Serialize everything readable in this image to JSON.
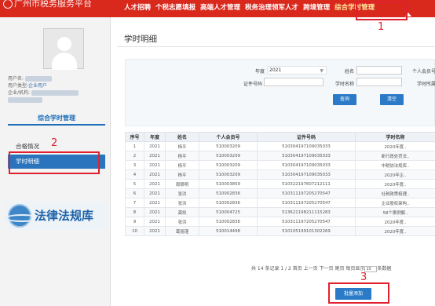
{
  "header": {
    "brand": "广州市税务服务平台",
    "nav": [
      "人才招聘",
      "个税志愿填报",
      "高端人才管理",
      "税务治理领军人才",
      "跨境管理",
      "综合学时管理"
    ],
    "active": "综合学时管理"
  },
  "sidebar": {
    "user_name_label": "用户名:",
    "user_type_label": "用户类型:",
    "user_type_value": "企业用户",
    "org_label": "企业/机构:",
    "section_title": "综合学时管理",
    "items": [
      "合格情况",
      "学时明细"
    ],
    "active_item": "学时明细",
    "law_label": "法律法规库"
  },
  "main": {
    "title": "学时明细",
    "filter": {
      "year_label": "年度",
      "year_value": "2021",
      "name_label": "姓名",
      "member_label": "个人会员号",
      "cert_label": "证件号码",
      "course_label": "学时名称",
      "other_label": "学时所属",
      "query_button": "查询",
      "clear_button": "清空"
    },
    "table": {
      "headers": [
        "序号",
        "年度",
        "姓名",
        "个人会员号",
        "证件号码",
        "学时名称"
      ],
      "rows": [
        [
          "1",
          "2021",
          "杨平",
          "510003209",
          "510304197109035033",
          "2020年度.."
        ],
        [
          "2",
          "2021",
          "杨平",
          "510003209",
          "510304197109035033",
          "新行政处罚法.."
        ],
        [
          "3",
          "2021",
          "杨平",
          "510003209",
          "510304197109035033",
          "中税协法规库.."
        ],
        [
          "4",
          "2021",
          "杨平",
          "510003209",
          "510304197109035033",
          "2020年企.."
        ],
        [
          "5",
          "2021",
          "周银明",
          "510003859",
          "510322197607212111",
          "2020年度.."
        ],
        [
          "6",
          "2021",
          "张洪",
          "510002836",
          "510311197205270547",
          "社税政策梳理.."
        ],
        [
          "7",
          "2021",
          "张洪",
          "510002836",
          "510311197205270547",
          "企业股权架构.."
        ],
        [
          "8",
          "2021",
          "龚凯",
          "510004725",
          "513621198211115283",
          "58个案例解.."
        ],
        [
          "9",
          "2021",
          "张洪",
          "510002836",
          "510311197205270547",
          "2020年度.."
        ],
        [
          "10",
          "2021",
          "葛丽瑾",
          "510014498",
          "510105199101302269",
          "2020年度.."
        ]
      ]
    },
    "pager": {
      "text": "共 14 条记录  1 / 2  首页  上一页  下一页  尾页  每页显示",
      "page_size": "10",
      "tail": "条数据"
    },
    "batch_button": "批量添加"
  },
  "annotations": {
    "label_1": "1",
    "label_2": "2",
    "label_3": "3"
  },
  "colors": {
    "header_red": "#d9281c",
    "accent_blue": "#2a7ac7",
    "annotation_red": "#e0202e"
  }
}
